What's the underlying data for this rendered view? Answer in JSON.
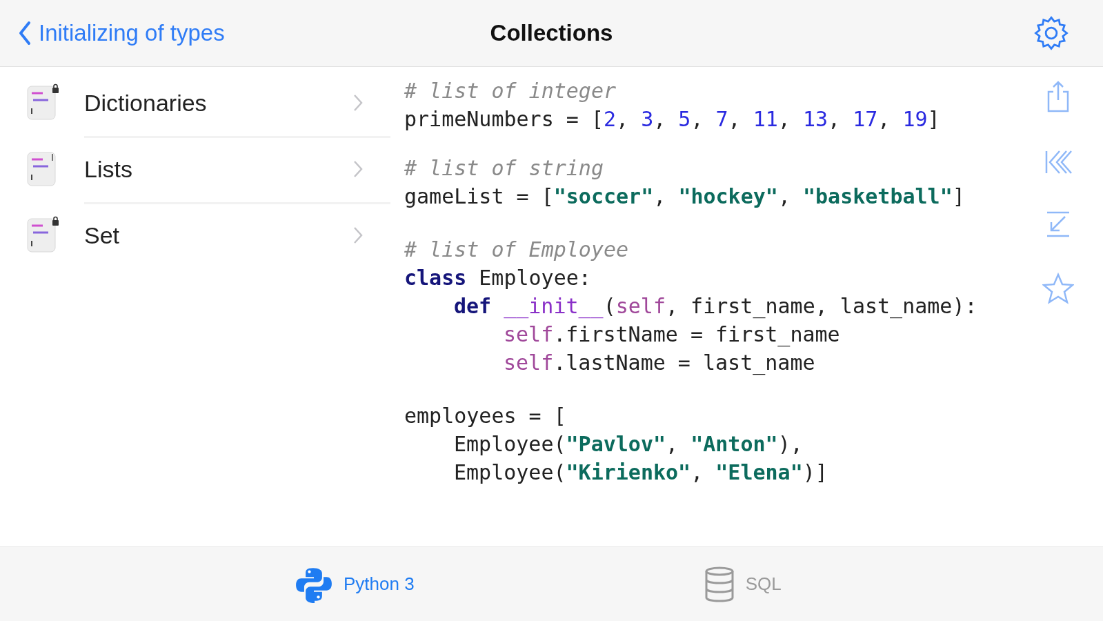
{
  "nav_bar": {
    "back_label": "Initializing of types",
    "title": "Collections"
  },
  "sidebar": {
    "items": [
      {
        "label": "Dictionaries",
        "locked": true
      },
      {
        "label": "Lists",
        "locked": false
      },
      {
        "label": "Set",
        "locked": true
      }
    ]
  },
  "code": {
    "blocks": [
      [
        {
          "tokens": [
            {
              "kind": "comment",
              "text": "# list of integer"
            }
          ]
        },
        {
          "tokens": [
            {
              "kind": "plain",
              "text": "primeNumbers = ["
            },
            {
              "kind": "number",
              "text": "2"
            },
            {
              "kind": "plain",
              "text": ", "
            },
            {
              "kind": "number",
              "text": "3"
            },
            {
              "kind": "plain",
              "text": ", "
            },
            {
              "kind": "number",
              "text": "5"
            },
            {
              "kind": "plain",
              "text": ", "
            },
            {
              "kind": "number",
              "text": "7"
            },
            {
              "kind": "plain",
              "text": ", "
            },
            {
              "kind": "number",
              "text": "11"
            },
            {
              "kind": "plain",
              "text": ", "
            },
            {
              "kind": "number",
              "text": "13"
            },
            {
              "kind": "plain",
              "text": ", "
            },
            {
              "kind": "number",
              "text": "17"
            },
            {
              "kind": "plain",
              "text": ", "
            },
            {
              "kind": "number",
              "text": "19"
            },
            {
              "kind": "plain",
              "text": "]"
            }
          ]
        }
      ],
      [
        {
          "tokens": [
            {
              "kind": "comment",
              "text": "# list of string"
            }
          ]
        },
        {
          "tokens": [
            {
              "kind": "plain",
              "text": "gameList = ["
            },
            {
              "kind": "string",
              "text": "\"soccer\""
            },
            {
              "kind": "plain",
              "text": ", "
            },
            {
              "kind": "string",
              "text": "\"hockey\""
            },
            {
              "kind": "plain",
              "text": ", "
            },
            {
              "kind": "string",
              "text": "\"basketball\""
            },
            {
              "kind": "plain",
              "text": "]"
            }
          ]
        }
      ],
      [
        {
          "tokens": [
            {
              "kind": "comment",
              "text": "# list of Employee"
            }
          ]
        },
        {
          "tokens": [
            {
              "kind": "keyword",
              "text": "class"
            },
            {
              "kind": "plain",
              "text": "Employee:"
            }
          ],
          "children": [
            {
              "tokens": [
                {
                  "kind": "keyword",
                  "text": "def"
                },
                {
                  "kind": "dunder",
                  "text": "__init__"
                },
                {
                  "kind": "plain",
                  "text": "("
                },
                {
                  "kind": "self",
                  "text": "self"
                },
                {
                  "kind": "plain",
                  "text": ", first_name, last_name):"
                }
              ],
              "children": [
                {
                  "tokens": [
                    {
                      "kind": "self",
                      "text": "self"
                    },
                    {
                      "kind": "plain",
                      "text": ".firstName = first_name"
                    }
                  ]
                },
                {
                  "tokens": [
                    {
                      "kind": "self",
                      "text": "self"
                    },
                    {
                      "kind": "plain",
                      "text": ".lastName = last_name"
                    }
                  ]
                }
              ]
            }
          ]
        }
      ],
      [
        {
          "tokens": [
            {
              "kind": "plain",
              "text": "employees = ["
            }
          ],
          "children": [
            {
              "tokens": [
                {
                  "kind": "plain",
                  "text": "Employee("
                },
                {
                  "kind": "string",
                  "text": "\"Pavlov\""
                },
                {
                  "kind": "plain",
                  "text": ", "
                },
                {
                  "kind": "string",
                  "text": "\"Anton\""
                },
                {
                  "kind": "plain",
                  "text": "),"
                }
              ]
            },
            {
              "tokens": [
                {
                  "kind": "plain",
                  "text": "Employee("
                },
                {
                  "kind": "string",
                  "text": "\"Kirienko\""
                },
                {
                  "kind": "plain",
                  "text": ", "
                },
                {
                  "kind": "string",
                  "text": "\"Elena\""
                },
                {
                  "kind": "plain",
                  "text": ")]"
                }
              ]
            }
          ]
        }
      ]
    ]
  },
  "tab_bar": {
    "tabs": [
      {
        "kind": "python",
        "label": "Python 3",
        "selected": true
      },
      {
        "kind": "database",
        "label": "SQL",
        "selected": false
      }
    ]
  }
}
